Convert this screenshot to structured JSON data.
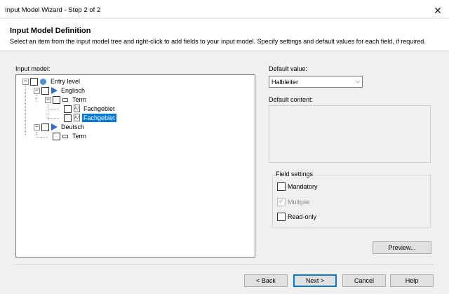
{
  "window": {
    "title": "Input Model Wizard - Step 2 of 2",
    "close_glyph": "✕"
  },
  "header": {
    "title": "Input Model Definition",
    "description": "Select an item from the input model tree and right-click to add fields to your input model. Specify settings and default values for each field, if required."
  },
  "input_model": {
    "label": "Input model:",
    "nodes": [
      {
        "label": "Entry level",
        "icon": "entry-circle-icon",
        "expanded": true
      },
      {
        "label": "Englisch",
        "icon": "language-triangle-icon",
        "expanded": true
      },
      {
        "label": "Term",
        "icon": "term-rectangle-icon",
        "expanded": true
      },
      {
        "label": "Fachgebiet",
        "icon": "field-icon",
        "selected": false
      },
      {
        "label": "Fachgebiet",
        "icon": "field-icon",
        "selected": true
      },
      {
        "label": "Deutsch",
        "icon": "language-triangle-icon",
        "expanded": true
      },
      {
        "label": "Term",
        "icon": "term-rectangle-icon"
      }
    ],
    "field_icon_glyph": "A/"
  },
  "default_value": {
    "label": "Default value:",
    "selected": "Halbleiter",
    "arrow_glyph": "⌵"
  },
  "default_content": {
    "label": "Default content:"
  },
  "field_settings": {
    "legend": "Field settings",
    "options": [
      {
        "label": "Mandatory",
        "checked": false,
        "enabled": true
      },
      {
        "label": "Multiple",
        "checked": true,
        "enabled": false
      },
      {
        "label": "Read-only",
        "checked": false,
        "enabled": true
      }
    ],
    "check_glyph": "✓"
  },
  "buttons": {
    "preview": "Preview...",
    "back": "< Back",
    "next": "Next >",
    "cancel": "Cancel",
    "help": "Help"
  },
  "colors": {
    "selection": "#0078d7",
    "language_icon": "#2f6fd6",
    "entry_icon": "#4a90d9"
  }
}
